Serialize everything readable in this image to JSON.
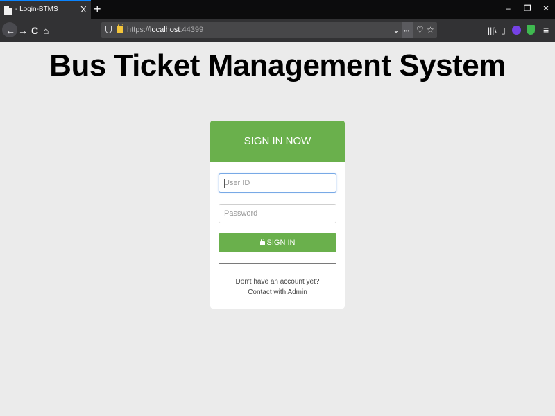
{
  "browser": {
    "tab": {
      "title": "- Login-BTMS",
      "close_glyph": "X"
    },
    "new_tab_glyph": "+",
    "window_controls": {
      "minimize": "–",
      "restore": "❐",
      "close": "✕"
    },
    "nav": {
      "back": "←",
      "forward": "→",
      "reload": "C",
      "home": "⌂"
    },
    "url": {
      "scheme": "https://",
      "host": "localhost",
      "port": ":44399"
    },
    "urlbar_icons": {
      "dropdown": "⌄",
      "more": "•••",
      "pocket": "♡",
      "bookmark": "☆"
    },
    "toolbar_icons": {
      "library": "|||\\",
      "sidebar": "▯",
      "menu": "≡"
    }
  },
  "page": {
    "title": "Bus Ticket Management System"
  },
  "login": {
    "header": "SIGN IN NOW",
    "user_id_placeholder": "User ID",
    "password_placeholder": "Password",
    "user_id_value": "",
    "password_value": "",
    "signin_label": "SIGN IN",
    "note_line1": "Don't have an account yet?",
    "note_line2": "Contact with Admin"
  },
  "colors": {
    "accent_green": "#6ab04c",
    "page_background": "#ebebeb",
    "browser_dark": "#0c0c0d"
  }
}
